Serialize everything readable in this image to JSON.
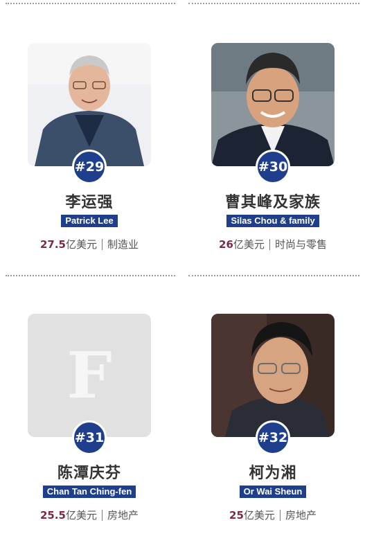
{
  "people": [
    {
      "rank": "#29",
      "name_cn": "李运强",
      "name_en": "Patrick Lee",
      "worth": "27.5",
      "unit": "亿美元",
      "industry": "制造业",
      "photo_icon": "portrait-photo"
    },
    {
      "rank": "#30",
      "name_cn": "曹其峰及家族",
      "name_en": "Silas Chou & family",
      "worth": "26",
      "unit": "亿美元",
      "industry": "时尚与零售",
      "photo_icon": "portrait-photo"
    },
    {
      "rank": "#31",
      "name_cn": "陈潭庆芬",
      "name_en": "Chan Tan Ching-fen",
      "worth": "25.5",
      "unit": "亿美元",
      "industry": "房地产",
      "photo_icon": "forbes-f-placeholder",
      "placeholder_letter": "F"
    },
    {
      "rank": "#32",
      "name_cn": "柯为湘",
      "name_en": "Or Wai Sheun",
      "worth": "25",
      "unit": "亿美元",
      "industry": "房地产",
      "photo_icon": "portrait-photo"
    }
  ],
  "colors": {
    "rank_badge": "#1f3f8c",
    "name_tag": "#1f3f8c",
    "worth": "#7a2a44"
  }
}
